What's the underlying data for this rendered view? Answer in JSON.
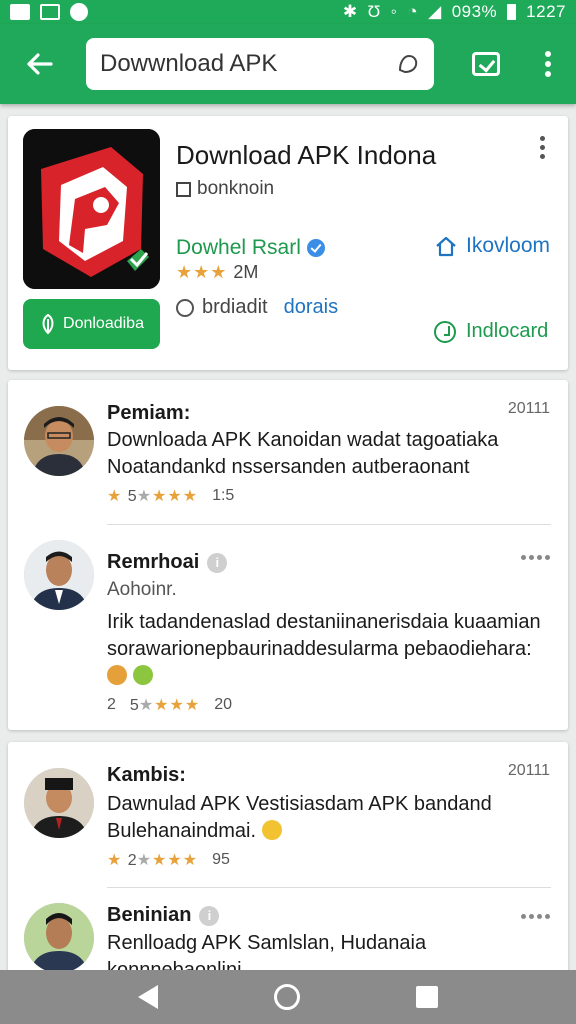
{
  "status_bar": {
    "battery": "093%",
    "time": "1227"
  },
  "app_bar": {
    "search_text": "Dowwnload APK"
  },
  "app": {
    "title": "Download APK Indona",
    "subtitle": "bonknoin",
    "developer": "Dowhel Rsarl",
    "rating_count": "2M",
    "home_link": "Ikovloom",
    "downloads_label": "brdiadit",
    "downloads_link": "dorais",
    "green_link": "Indlocard",
    "install_label": "Donloadiba",
    "colors": {
      "accent": "#21a95b",
      "link": "#1f74c2",
      "icon_red": "#d8232a"
    }
  },
  "reviews_card_1": [
    {
      "name": "Pemiam:",
      "date": "20111",
      "text": "Downloada APK Kanoidan wadat tagoatiaka Noatandankd nssersanden autberaonant",
      "stars_text": "5",
      "likes": "1:5"
    },
    {
      "name": "Remrhoai",
      "subtitle": "Aohoinr.",
      "text": "Irik tadandenaslad destaniinanerisdaia kuaamian sorawarionepbaurinaddesularma pebaodiehara:",
      "stars_prefix": "2",
      "stars_text": "5",
      "likes": "20"
    }
  ],
  "reviews_card_2": [
    {
      "name": "Kambis:",
      "date": "20111",
      "text": "Dawnulad APK Vestisiasdam APK bandand Bulehanaindmai.",
      "stars_text": "2",
      "likes": "95"
    },
    {
      "name": "Beninian",
      "text": "Renlloadg APK Samlslan, Hudanaia konnnebaonlini"
    }
  ]
}
